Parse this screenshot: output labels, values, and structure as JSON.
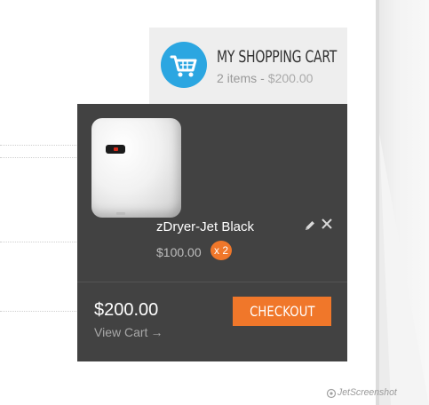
{
  "cart_header": {
    "title": "MY SHOPPING CART",
    "item_count_text": "2 items",
    "separator": "-",
    "total_text": "$200.00",
    "icon": "shopping-cart-icon",
    "icon_color": "#2ba6e1"
  },
  "dropdown": {
    "items": [
      {
        "name": "zDryer-Jet Black",
        "price": "$100.00",
        "quantity": "x 2",
        "image_icon": "hand-dryer-image"
      }
    ],
    "edit_icon": "pencil-icon",
    "remove_icon": "close-icon",
    "total": "$200.00",
    "view_cart_label": "View Cart",
    "view_cart_arrow": "→",
    "checkout_label": "CHECKOUT",
    "accent_color": "#f0772a",
    "background_color": "#424242"
  },
  "watermark": {
    "text": "JetScreenshot"
  }
}
